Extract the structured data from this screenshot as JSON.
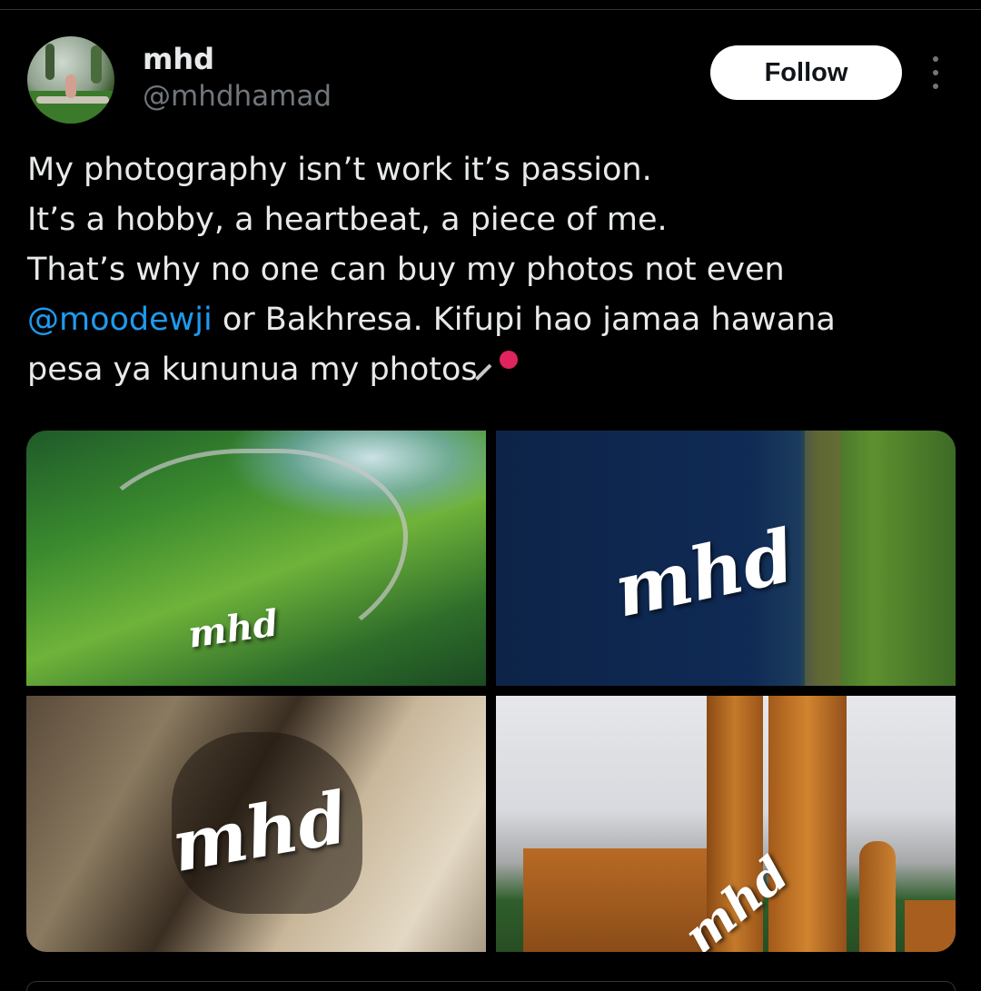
{
  "author": {
    "name": "mhd",
    "handle": "@mhdhamad",
    "follow_label": "Follow",
    "more_icon": "more-dots-icon"
  },
  "tweet": {
    "line1": "My photography isn’t work it’s passion.",
    "line2": "It’s a hobby, a heartbeat, a piece of me.",
    "line3": "That’s why no one can buy my photos not even",
    "mention": "@moodewji",
    "line4_rest": " or Bakhresa. Kifupi hao jamaa hawana",
    "line5": "pesa ya kununua my photos",
    "emoji_icon": "pushpin-icon"
  },
  "media": {
    "photos": [
      {
        "watermark": "mhd"
      },
      {
        "watermark": "mhd"
      },
      {
        "watermark": "mhd"
      },
      {
        "watermark": "mhd"
      }
    ]
  },
  "colors": {
    "background": "#000000",
    "text": "#e7e9ea",
    "muted": "#71767b",
    "link": "#1d9bf0",
    "button_bg": "#ffffff"
  }
}
